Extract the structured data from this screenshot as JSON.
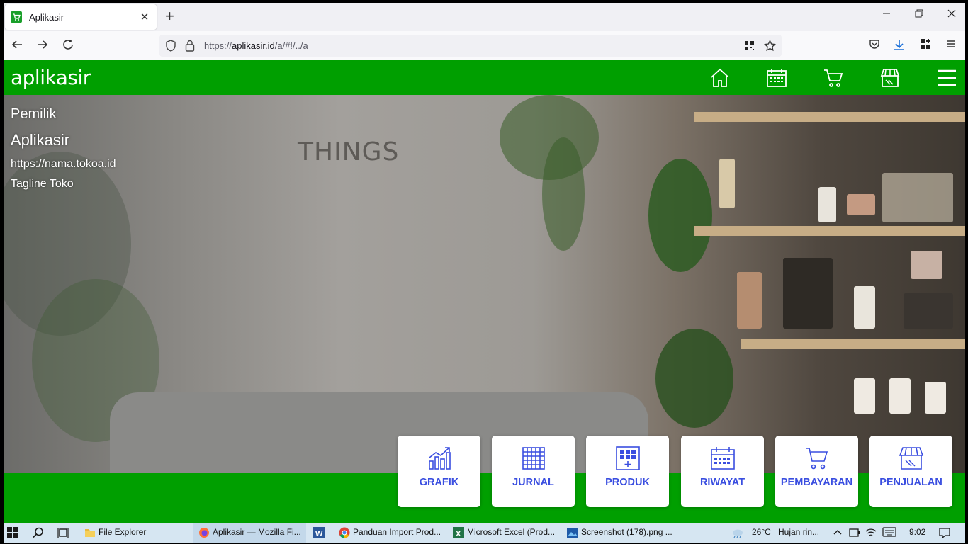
{
  "browser": {
    "tab_title": "Aplikasir",
    "tab_close": "✕",
    "new_tab": "+",
    "url_host": "aplikasir.id",
    "url_prefix": "https://",
    "url_path": "/a/#!/../a"
  },
  "app": {
    "logo": "aplikasir",
    "nav_icons": [
      "home-icon",
      "calendar-icon",
      "cart-icon",
      "store-icon",
      "menu-icon"
    ]
  },
  "hero": {
    "owner": "Pemilik",
    "store_name": "Aplikasir",
    "store_url": "https://nama.tokoa.id",
    "tagline": "Tagline Toko",
    "wall_sign": "THINGS"
  },
  "menu_cards": [
    {
      "label": "GRAFIK",
      "icon": "chart-icon"
    },
    {
      "label": "JURNAL",
      "icon": "table-icon"
    },
    {
      "label": "PRODUK",
      "icon": "product-grid-icon"
    },
    {
      "label": "RIWAYAT",
      "icon": "calendar-icon"
    },
    {
      "label": "PEMBAYARAN",
      "icon": "cart-icon"
    },
    {
      "label": "PENJUALAN",
      "icon": "store-icon"
    }
  ],
  "colors": {
    "brand_green": "#009f00",
    "card_text": "#3a4ee0"
  },
  "taskbar": {
    "file_explorer": "File Explorer",
    "firefox": "Aplikasir — Mozilla Fi...",
    "chrome": "Panduan Import Prod...",
    "excel": "Microsoft Excel (Prod...",
    "screenshot": "Screenshot (178).png ...",
    "weather_temp": "26°C",
    "weather_text": "Hujan rin...",
    "time": "9:02"
  }
}
